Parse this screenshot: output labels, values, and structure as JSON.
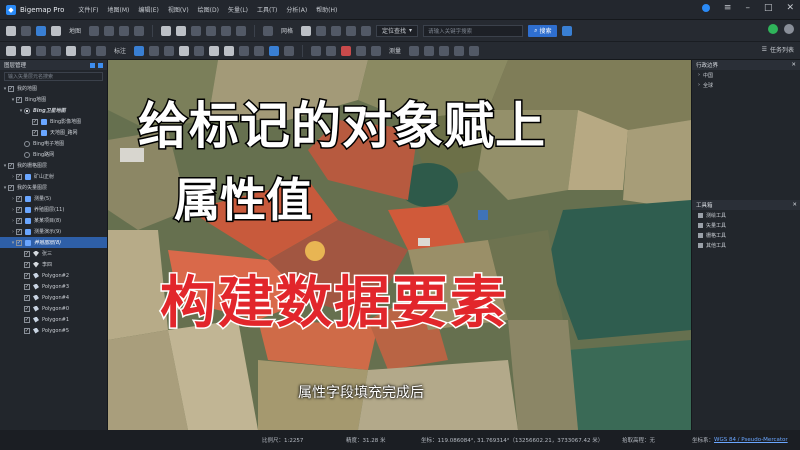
{
  "app": {
    "title": "Bigemap Pro",
    "menu": [
      "文件(F)",
      "地图(M)",
      "编辑(E)",
      "视图(V)",
      "绘图(D)",
      "矢量(L)",
      "工具(T)",
      "分析(A)",
      "帮助(H)"
    ]
  },
  "toolbar": {
    "map_label": "地图",
    "grid_label": "网格",
    "locate_dropdown": "定位查找",
    "search_placeholder": "请输入关键字搜索",
    "search_button": "搜索",
    "annotate_label": "标注",
    "measure_label": "测量",
    "task_list": "任务列表"
  },
  "layer_panel": {
    "title": "图层管理",
    "filter_placeholder": "输入矢量层元名搜索",
    "nodes": [
      {
        "label": "我的地图",
        "kind": "folder"
      },
      {
        "label": "Bing地图",
        "kind": "group"
      },
      {
        "label": "Bing卫星地图",
        "kind": "radio-on"
      },
      {
        "label": "Bing影像地图",
        "kind": "check"
      },
      {
        "label": "天地图_路网",
        "kind": "check"
      },
      {
        "label": "Bing电子地图",
        "kind": "radio"
      },
      {
        "label": "Bing路网",
        "kind": "radio"
      },
      {
        "label": "我的栅格图层",
        "kind": "folder"
      },
      {
        "label": "矿山正射",
        "kind": "check"
      },
      {
        "label": "我的矢量图层",
        "kind": "folder"
      },
      {
        "label": "测量(5)",
        "kind": "check"
      },
      {
        "label": "养殖图层(11)",
        "kind": "check"
      },
      {
        "label": "某某项目(8)",
        "kind": "check"
      },
      {
        "label": "测量演示(9)",
        "kind": "check"
      },
      {
        "label": "养殖图层(8)",
        "kind": "selected"
      },
      {
        "label": "张三",
        "kind": "point"
      },
      {
        "label": "李四",
        "kind": "point"
      },
      {
        "label": "Polygon#2",
        "kind": "poly"
      },
      {
        "label": "Polygon#3",
        "kind": "poly"
      },
      {
        "label": "Polygon#4",
        "kind": "poly"
      },
      {
        "label": "Polygon#0",
        "kind": "poly"
      },
      {
        "label": "Polygon#1",
        "kind": "poly"
      },
      {
        "label": "Polygon#5",
        "kind": "poly"
      }
    ]
  },
  "overlay": {
    "line1": "给标记的对象赋上",
    "line2": "属性值",
    "line3": "构建数据要素",
    "subtitle": "属性字段填充完成后"
  },
  "right_panel": {
    "admin_title": "行政边界",
    "admin_items": [
      "中国",
      "全球"
    ],
    "tools_title": "工具箱",
    "tools_items": [
      "测绘工具",
      "矢量工具",
      "栅格工具",
      "其他工具"
    ]
  },
  "status": {
    "scale": "比例尺：1:2257",
    "resolution": "精度：31.28 米",
    "coords": "坐标：119.086084°, 31.769314°（13256602.21，3733067.42 米）",
    "hover_label": "拾取高程：无",
    "crs_label": "坐标系：",
    "crs_value": "WGS 84 / Pseudo-Mercator"
  }
}
